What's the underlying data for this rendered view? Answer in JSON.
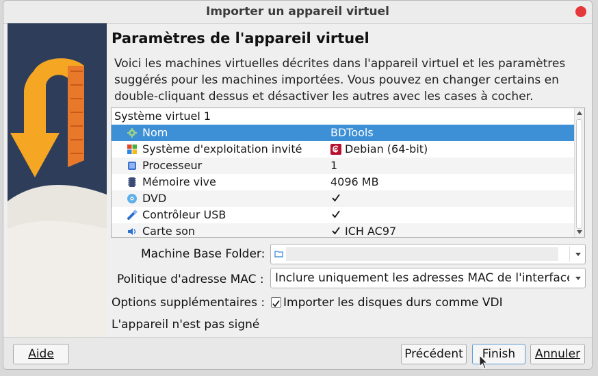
{
  "window": {
    "title": "Importer un appareil virtuel"
  },
  "page": {
    "heading": "Paramètres de l'appareil virtuel",
    "description": "Voici les machines virtuelles décrites dans l'appareil virtuel et les paramètres suggérés pour les machines importées. Vous pouvez en changer certains en double-cliquant dessus et désactiver les autres avec les cases à cocher."
  },
  "tree": {
    "group": "Système virtuel 1",
    "rows": [
      {
        "label": "Nom",
        "value": "BDTools",
        "icon": "gear-icon",
        "selected": true
      },
      {
        "label": "Système d'exploitation invité",
        "value": "Debian (64-bit)",
        "icon": "os-icon",
        "value_icon": "debian-icon"
      },
      {
        "label": "Processeur",
        "value": "1",
        "icon": "cpu-icon"
      },
      {
        "label": "Mémoire vive",
        "value": "4096 MB",
        "icon": "ram-icon"
      },
      {
        "label": "DVD",
        "value": "",
        "icon": "dvd-icon",
        "checked": true
      },
      {
        "label": "Contrôleur USB",
        "value": "",
        "icon": "usb-icon",
        "checked": true
      },
      {
        "label": "Carte son",
        "value": "ICH AC97",
        "icon": "sound-icon",
        "checked": true
      }
    ]
  },
  "fields": {
    "base_folder_label": "Machine Base Folder:",
    "base_folder_value": "",
    "mac_policy_label": "Politique d'adresse MAC :",
    "mac_policy_value": "Inclure uniquement les adresses MAC de l'interface",
    "extra_options_label": "Options supplémentaires :",
    "import_vdi_label": "Importer les disques durs comme VDI",
    "import_vdi_checked": true,
    "signature_status": "L'appareil n'est pas signé"
  },
  "buttons": {
    "help": "Aide",
    "back": "Précédent",
    "finish": "Finish",
    "cancel": "Annuler"
  },
  "colors": {
    "selection": "#3d8fd6",
    "accent_orange": "#f5a623"
  }
}
